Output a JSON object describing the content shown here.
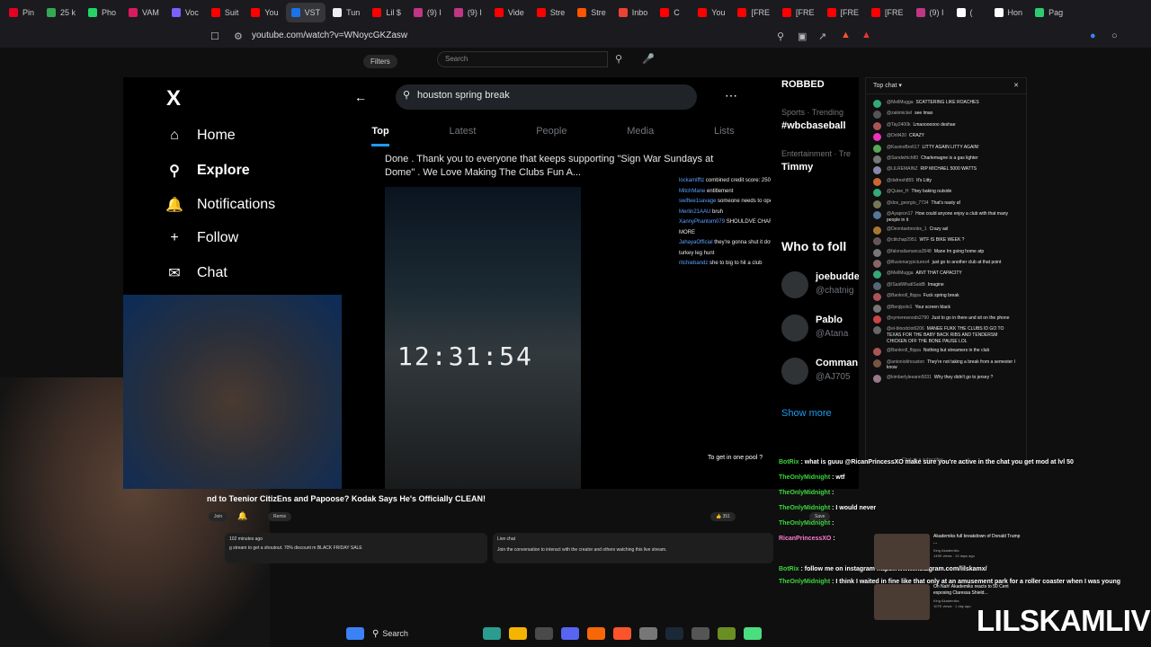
{
  "browser": {
    "tabs": [
      {
        "label": "Pin",
        "color": "#e60023"
      },
      {
        "label": "25 k",
        "color": "#34a853"
      },
      {
        "label": "Pho",
        "color": "#25d366"
      },
      {
        "label": "VAM",
        "color": "#d81b60"
      },
      {
        "label": "Voc",
        "color": "#7b61ff"
      },
      {
        "label": "Suit",
        "color": "#ff0000"
      },
      {
        "label": "You",
        "color": "#ff0000"
      },
      {
        "label": "VST",
        "color": "#1a73e8"
      },
      {
        "label": "Tun",
        "color": "#eeeeee"
      },
      {
        "label": "Lil $",
        "color": "#ff0000"
      },
      {
        "label": "(9) I",
        "color": "#c13584"
      },
      {
        "label": "(9) I",
        "color": "#c13584"
      },
      {
        "label": "Vide",
        "color": "#ff0000"
      },
      {
        "label": "Stre",
        "color": "#ff0000"
      },
      {
        "label": "Stre",
        "color": "#ff5500"
      },
      {
        "label": "Inbo",
        "color": "#ea4335"
      },
      {
        "label": "C",
        "color": "#ff0000"
      },
      {
        "label": "You",
        "color": "#ff0000"
      },
      {
        "label": "[FRE",
        "color": "#ff0000"
      },
      {
        "label": "[FRE",
        "color": "#ff0000"
      },
      {
        "label": "[FRE",
        "color": "#ff0000"
      },
      {
        "label": "[FRE",
        "color": "#ff0000"
      },
      {
        "label": "(9) I",
        "color": "#c13584"
      },
      {
        "label": "(",
        "color": "#ffffff"
      },
      {
        "label": "Hon",
        "color": "#ffffff"
      },
      {
        "label": "Pag",
        "color": "#2ecc71"
      }
    ],
    "url": "youtube.com/watch?v=WNoycGKZasw"
  },
  "youtube": {
    "filters_label": "Filters",
    "search_placeholder": "Search",
    "video_title": "nd to Teenior CitizEns and Papoose? Kodak Says He's Officially CLEAN!",
    "join_label": "Join",
    "remix_label": "Remix",
    "like_count": "351",
    "save_label": "Save",
    "meta_time": "102 minutes ago",
    "description": "g stream to get a shoutout. 70% discount m BLACK FRIDAY SALE",
    "live_chat_title": "Live chat",
    "live_chat_desc": "Join the conversation to interact with the creator and others watching this live stream."
  },
  "x_screen": {
    "logo": "X",
    "nav": [
      "Home",
      "Explore",
      "Notifications",
      "Follow",
      "Chat"
    ],
    "search_query": "houston spring break",
    "tabs": [
      "Top",
      "Latest",
      "People",
      "Media",
      "Lists"
    ],
    "tweet_text": "Done . Thank you to everyone that keeps supporting \"Sign War Sundays at Dome\" . We Love Making The Clubs Fun A...",
    "video_timer": "12:31:54",
    "overlay_chat": [
      {
        "user": "lockamifftz",
        "text": "combined credit score: 250"
      },
      {
        "user": "MitchMane",
        "text": "entitlement"
      },
      {
        "user": "swiftee1savage",
        "text": "someone needs to open up some more clubs"
      },
      {
        "user": "Merlin21AAU",
        "text": "bruh"
      },
      {
        "user": "XannyPhantom079",
        "text": "SHOULDVE CHARGED THEM HOES MORE"
      },
      {
        "user": "JahayaOfficial",
        "text": "they're gonna shut it down like they did the turkey leg hunt"
      },
      {
        "user": "ritchiebandz",
        "text": "she to big to hit a club"
      }
    ],
    "right_trends": [
      "ROBBED",
      "Sports · Trending",
      "#wbcbaseball",
      "Entertainment · Tre",
      "Timmy",
      "Who to foll"
    ],
    "follow_suggestions": [
      {
        "name": "joebudde",
        "handle": "@chatnig"
      },
      {
        "name": "Pablo",
        "handle": "@Atana"
      },
      {
        "name": "Comman",
        "handle": "@AJ705"
      }
    ],
    "show_more": "Show more",
    "pool_line": "To get in one pool ?"
  },
  "chat_panel": {
    "title": "Top chat",
    "messages": [
      {
        "user": "@MellMugga",
        "text": "SCATTERING LIKE ROACHES"
      },
      {
        "user": "@zakimickel",
        "text": "see lmao"
      },
      {
        "user": "@Tay2400k",
        "text": "Lmaooooooo deshae"
      },
      {
        "user": "@Drill420",
        "text": "CRAZY"
      },
      {
        "user": "@KasinoBro617",
        "text": "LITTY AGAIN LITTY AGAIN!"
      },
      {
        "user": "@Sandwhich80",
        "text": "Charlemagne is a gas lighter"
      },
      {
        "user": "@LILREMAINZ",
        "text": "RIP MICHAEL 5000 WATTS"
      },
      {
        "user": "@dafresh855",
        "text": "It's Litty"
      },
      {
        "user": "@Quise_H",
        "text": "They baking outside"
      },
      {
        "user": "@dos_georgio_7734",
        "text": "That's nasty af"
      },
      {
        "user": "@Ayapron17",
        "text": "How could anyone enjoy a club with that many people in it"
      },
      {
        "user": "@Deontaebrooks_1",
        "text": "Crazy asl"
      },
      {
        "user": "@ctitchap2951",
        "text": "WTF IS BIKE WEEK ?"
      },
      {
        "user": "@falonaliamanca3548",
        "text": "Mane Im going home atp"
      },
      {
        "user": "@illusionarypictures4",
        "text": "just go to another club at that point"
      },
      {
        "user": "@MellMugga",
        "text": "AINT THAT CAPACITY"
      },
      {
        "user": "@ISaidWhatISaidB",
        "text": "Imagine"
      },
      {
        "user": "@Bankroll_flippa",
        "text": "Fuck spring break"
      },
      {
        "user": "@Benjipolo1",
        "text": "Your screen black"
      },
      {
        "user": "@symerewoods2790",
        "text": "Just to go in there and sit on the phone"
      },
      {
        "user": "@el-bloodclot6206",
        "text": "MANEE FUKK THE CLUBS ID GO TO TEXAS FOR THE BABY BACK RIBS AND TENDERSM CHICKEN OFF THE BONE PAUSE LOL"
      },
      {
        "user": "@Bankroll_flippa",
        "text": "Nothing but streamers in the club"
      },
      {
        "user": "@antoniobhouston",
        "text": "They're not taking a break from a semester I know"
      },
      {
        "user": "@kimberlyleeann5031",
        "text": "Why they didn't go to jersey ?"
      }
    ],
    "input_placeholder": "Chat as a subscriber..."
  },
  "stream_overlay": [
    {
      "user": "BotRix",
      "text": "what is guuu @RicanPrincessXO make sure you're active in the chat you get mod at lvl 50",
      "color": "green"
    },
    {
      "user": "TheOnlyMidnight",
      "text": "wtf",
      "color": "green"
    },
    {
      "user": "TheOnlyMidnight",
      "text": "",
      "color": "green"
    },
    {
      "user": "TheOnlyMidnight",
      "text": "I would never",
      "color": "green"
    },
    {
      "user": "TheOnlyMidnight",
      "text": "",
      "color": "green"
    },
    {
      "user": "RicanPrincessXO",
      "text": "",
      "color": "pink"
    },
    {
      "user": "BotRix",
      "text": "follow me on instagram https://www.instagram.com/lilskamx/",
      "color": "green"
    },
    {
      "user": "TheOnlyMidnight",
      "text": "I think I waited in fine like that only at an amusement park for a roller coaster when I was young",
      "color": "green"
    }
  ],
  "recommendations": [
    {
      "title": "Akademiks full breakdown of Donald Trump ...",
      "channel": "King Akademiks",
      "meta": "149K views · 13 days ago"
    },
    {
      "title": "Oh Nah! Akademiks reacts to 50 Cent exposing Claressa Shield...",
      "channel": "King Akademiks",
      "meta": "107K views · 1 day ago"
    }
  ],
  "brand": "LILSKAMLIVE",
  "taskbar": {
    "search_label": "Search"
  }
}
